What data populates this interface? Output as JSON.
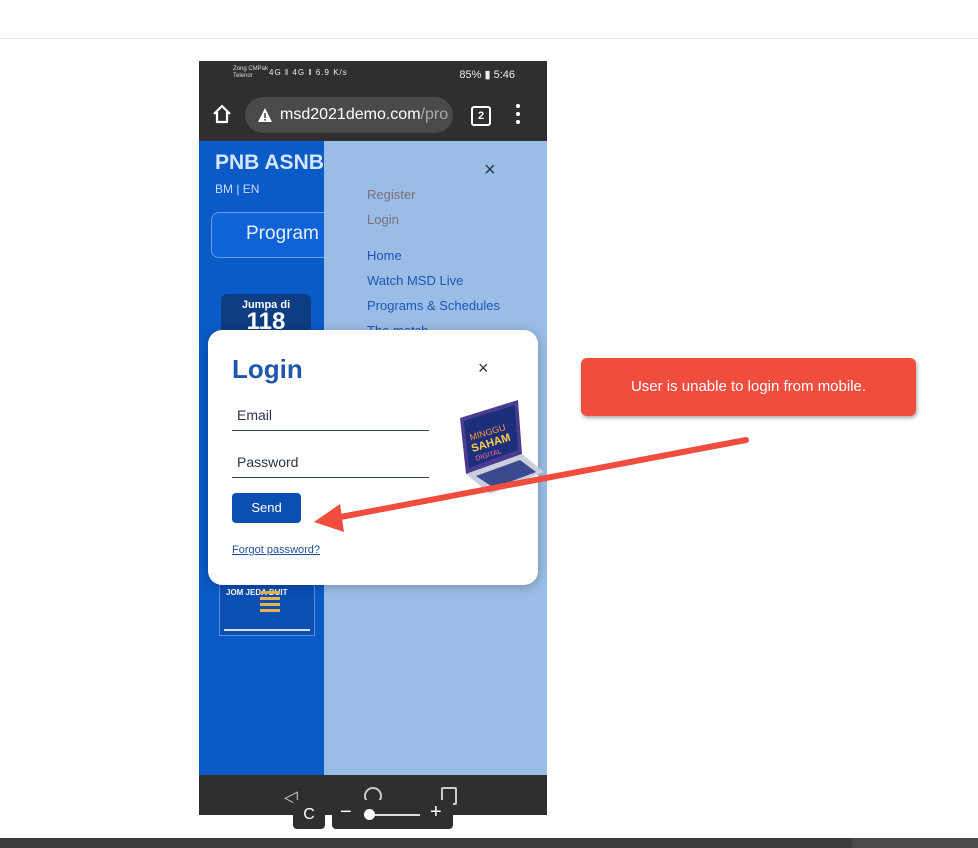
{
  "phone": {
    "status": {
      "carrier_1": "Zong CMPak",
      "carrier_2": "Telenor",
      "signal": "4G ‖ 4G ‖",
      "speed": "6.9 K/s",
      "right": "85% ▮ 5:46"
    },
    "browser": {
      "url_main": "msd2021demo.com",
      "url_rest": "/pro",
      "tab_count": "2"
    },
    "site": {
      "brand": "PNB ASNB",
      "lang": "BM | EN",
      "program_button": "Program",
      "jumpa_line1": "Jumpa di",
      "jumpa_line2": "118",
      "poster_text": "JOM JEDA DUIT"
    },
    "drawer": {
      "close": "×",
      "items": [
        "Register",
        "Login",
        "Home",
        "Watch MSD Live",
        "Programs & Schedules",
        "The match"
      ]
    },
    "nav": {
      "back": "◁"
    }
  },
  "login_modal": {
    "title": "Login",
    "close": "×",
    "email_label": "Email",
    "password_label": "Password",
    "send_label": "Send",
    "forgot_label": "Forgot password?"
  },
  "annotation": {
    "callout_text": "User is unable to login from mobile.",
    "color": "#f04d3e"
  },
  "viewer": {
    "refresh": "C",
    "zoom_minus": "−",
    "zoom_plus": "+"
  }
}
